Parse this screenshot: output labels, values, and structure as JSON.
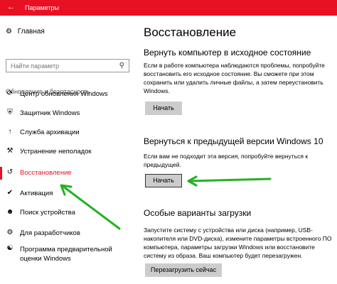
{
  "window": {
    "title": "Параметры",
    "back_icon": "back-arrow-icon",
    "accent": "#e81123"
  },
  "sidebar": {
    "home_label": "Главная",
    "search_placeholder": "Найти параметр",
    "section_title": "Обновление и безопасность",
    "items": [
      {
        "label": "Центр обновления Windows",
        "icon": "refresh-icon"
      },
      {
        "label": "Защитник Windows",
        "icon": "shield-icon"
      },
      {
        "label": "Служба архивации",
        "icon": "upload-icon"
      },
      {
        "label": "Устранение неполадок",
        "icon": "wrench-icon"
      },
      {
        "label": "Восстановление",
        "icon": "history-icon",
        "active": true
      },
      {
        "label": "Активация",
        "icon": "check-circle-icon"
      },
      {
        "label": "Поиск устройства",
        "icon": "person-search-icon"
      },
      {
        "label": "Для разработчиков",
        "icon": "developer-icon"
      },
      {
        "label": "Программа предварительной оценки Windows",
        "icon": "insider-icon"
      }
    ]
  },
  "main": {
    "title": "Восстановление",
    "reset": {
      "heading": "Вернуть компьютер в исходное состояние",
      "text": "Если в работе компьютера наблюдаются проблемы, попробуйте восстановить его исходное состояние. Вы сможете при этом сохранить или удалить личные файлы, а затем переустановить Windows.",
      "button": "Начать"
    },
    "rollback": {
      "heading": "Вернуться к предыдущей версии Windows 10",
      "text": "Если вам не подходит эта версия, попробуйте вернуться к предыдущей.",
      "button": "Начать"
    },
    "advanced": {
      "heading": "Особые варианты загрузки",
      "text": "Запустите систему с устройства или диска (например, USB-накопителя или DVD-диска), измените параметры встроенного ПО компьютера, параметры загрузки Windows или восстановите систему из образа. Ваш компьютер будет перезагружен.",
      "button": "Перезагрузить сейчас"
    }
  }
}
